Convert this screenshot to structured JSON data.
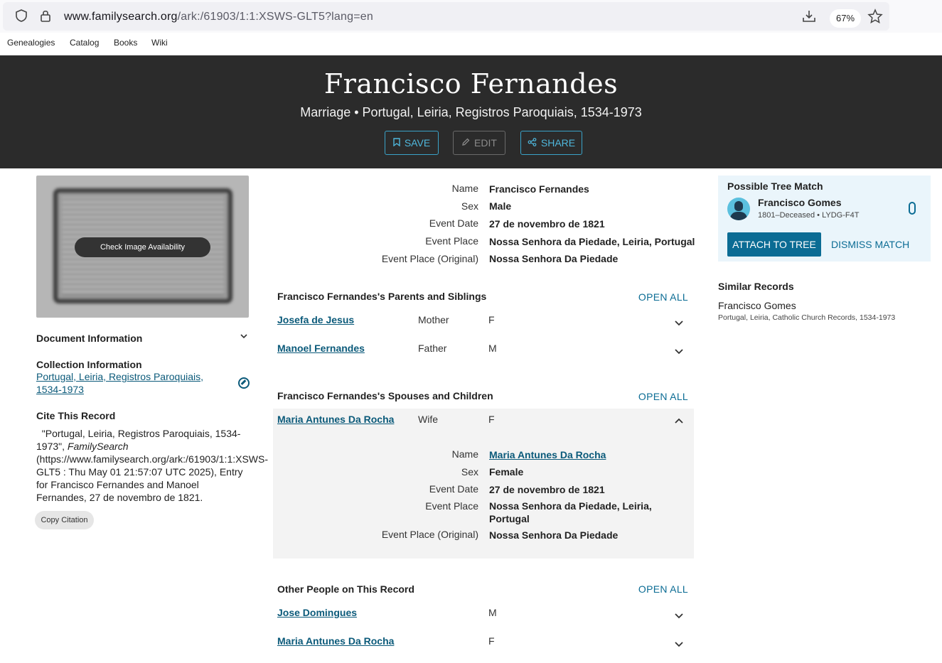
{
  "browser": {
    "url_domain": "www.familysearch.org",
    "url_path": "/ark:/61903/1:1:XSWS-GLT5?lang=en",
    "zoom": "67%"
  },
  "nav": [
    "Genealogies",
    "Catalog",
    "Books",
    "Wiki"
  ],
  "header": {
    "title": "Francisco Fernandes",
    "subtitle": "Marriage • Portugal, Leiria, Registros Paroquiais, 1534-1973",
    "save": "SAVE",
    "edit": "EDIT",
    "share": "SHARE"
  },
  "left": {
    "check_image": "Check Image Availability",
    "doc_info": "Document Information",
    "collection_heading": "Collection Information",
    "collection_link": "Portugal, Leiria, Registros Paroquiais, 1534-1973",
    "cite_heading": "Cite This Record",
    "cite_pre": "\"Portugal, Leiria, Registros Paroquiais, 1534-1973\", ",
    "cite_italic": "FamilySearch",
    "cite_post": " (https://www.familysearch.org/ark:/61903/1:1:XSWS-GLT5 : Thu May 01 21:57:07 UTC 2025), Entry for Francisco Fernandes and Manoel Fernandes, 27 de novembro de 1821.",
    "copy_citation": "Copy Citation"
  },
  "details": {
    "name_label": "Name",
    "name": "Francisco Fernandes",
    "sex_label": "Sex",
    "sex": "Male",
    "date_label": "Event Date",
    "date": "27 de novembro de 1821",
    "place_label": "Event Place",
    "place": "Nossa Senhora da Piedade, Leiria, Portugal",
    "orig_label": "Event Place (Original)",
    "orig": "Nossa Senhora Da Piedade"
  },
  "parents": {
    "title": "Francisco Fernandes's Parents and Siblings",
    "open_all": "OPEN ALL",
    "rows": [
      {
        "name": "Josefa de Jesus",
        "rel": "Mother",
        "sex": "F"
      },
      {
        "name": "Manoel Fernandes",
        "rel": "Father",
        "sex": "M"
      }
    ]
  },
  "spouses": {
    "title": "Francisco Fernandes's Spouses and Children",
    "open_all": "OPEN ALL",
    "row": {
      "name": "Maria Antunes Da Rocha",
      "rel": "Wife",
      "sex": "F"
    },
    "expanded": {
      "name_label": "Name",
      "name": "Maria Antunes Da Rocha",
      "sex_label": "Sex",
      "sex": "Female",
      "date_label": "Event Date",
      "date": "27 de novembro de 1821",
      "place_label": "Event Place",
      "place_line1": "Nossa Senhora da Piedade, Leiria,",
      "place_line2": "Portugal",
      "orig_label": "Event Place (Original)",
      "orig": "Nossa Senhora Da Piedade"
    }
  },
  "others": {
    "title": "Other People on This Record",
    "open_all": "OPEN ALL",
    "rows": [
      {
        "name": "Jose Domingues",
        "sex": "M"
      },
      {
        "name": "Maria Antunes Da Rocha",
        "sex": "F"
      }
    ]
  },
  "right": {
    "match_title": "Possible Tree Match",
    "match_name": "Francisco Gomes",
    "match_meta": "1801–Deceased • LYDG-F4T",
    "attach": "ATTACH TO TREE",
    "dismiss": "DISMISS MATCH",
    "similar_title": "Similar Records",
    "similar_name": "Francisco Gomes",
    "similar_meta": "Portugal, Leiria, Catholic Church Records, 1534-1973"
  },
  "colors": {
    "header_bg": "#2b2b2b",
    "accent": "#0b6c94",
    "match_bg": "#eaf5fb"
  }
}
